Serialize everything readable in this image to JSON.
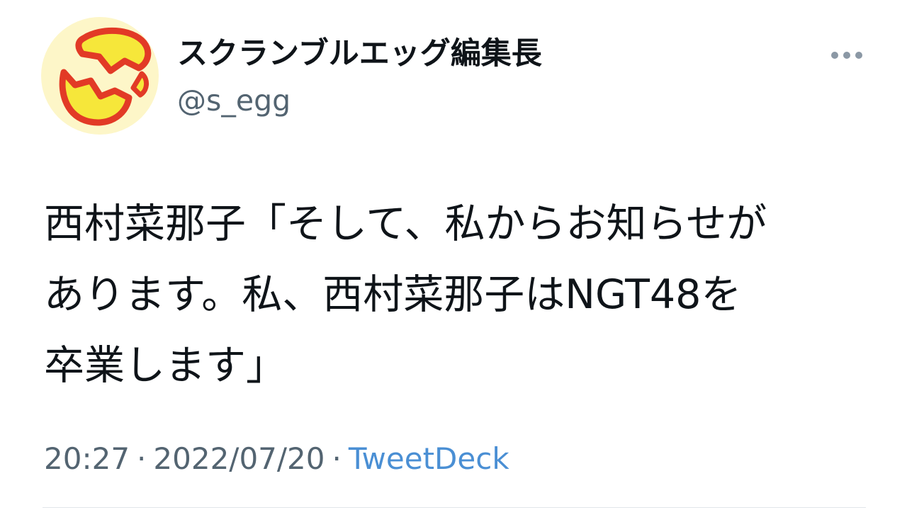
{
  "author": {
    "display_name": "スクランブルエッグ編集長",
    "handle": "@s_egg",
    "avatar_icon": "cracked-egg-icon"
  },
  "menu": {
    "icon": "more-options-icon"
  },
  "tweet": {
    "lines": [
      "西村菜那子「そして、私からお知らせが",
      "あります。私、西村菜那子はNGT48を",
      "卒業します」"
    ]
  },
  "meta": {
    "time": "20:27",
    "date": "2022/07/20",
    "separator": "·",
    "source": "TweetDeck"
  },
  "colors": {
    "text": "#0f1419",
    "secondary_text": "#536471",
    "link": "#4a8fd4",
    "avatar_background": "#fdf6c8",
    "egg_yellow": "#f6e73a",
    "egg_red": "#e23a26"
  }
}
